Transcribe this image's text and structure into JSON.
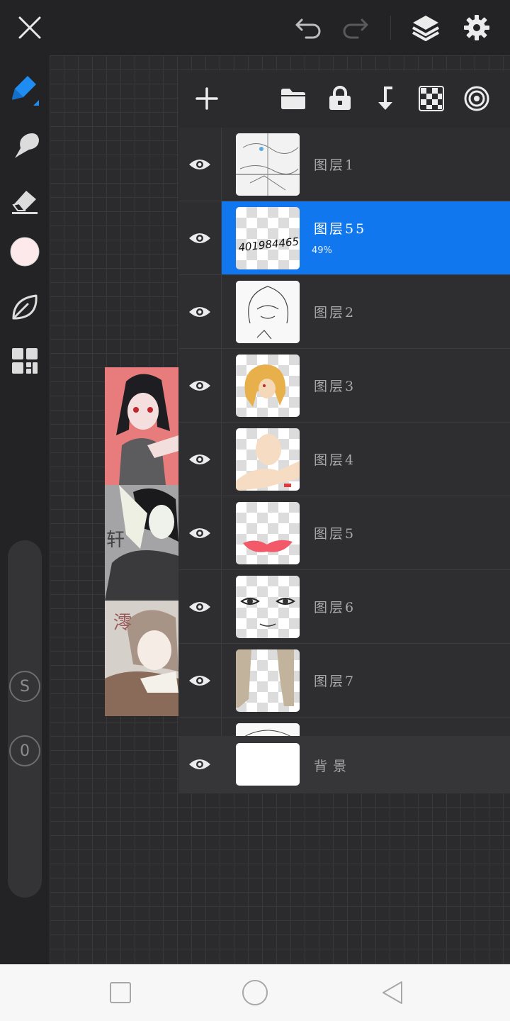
{
  "colors": {
    "accent": "#1177ee",
    "panel": "#2e2e30",
    "toolbar": "#232325"
  },
  "topbar": {
    "icons": [
      "close-icon",
      "undo-icon",
      "redo-icon",
      "layers-icon",
      "gear-icon"
    ]
  },
  "toolbar": {
    "icons": [
      "pen-icon",
      "smudge-icon",
      "eraser-icon",
      "color-swatch",
      "leaf-icon",
      "grid-icon"
    ],
    "size_badge": "S",
    "opacity_badge": "0",
    "color": "#fde9ea"
  },
  "layers_panel": {
    "actions": [
      "add-icon",
      "folder-icon",
      "lock-icon",
      "merge-down-icon",
      "checker-icon",
      "radial-icon"
    ],
    "layers": [
      {
        "name": "图层1",
        "opacity": ""
      },
      {
        "name": "图层55",
        "opacity": "49%",
        "thumb_text": "401984465"
      },
      {
        "name": "图层2",
        "opacity": ""
      },
      {
        "name": "图层3",
        "opacity": ""
      },
      {
        "name": "图层4",
        "opacity": ""
      },
      {
        "name": "图层5",
        "opacity": ""
      },
      {
        "name": "图层6",
        "opacity": ""
      },
      {
        "name": "图层7",
        "opacity": ""
      }
    ],
    "selected_index": 1,
    "background": {
      "name": "背景"
    }
  },
  "artwork": {
    "labels": [
      "轩",
      "澪"
    ]
  },
  "navbar": {
    "icons": [
      "recents-icon",
      "home-icon",
      "back-icon"
    ]
  }
}
